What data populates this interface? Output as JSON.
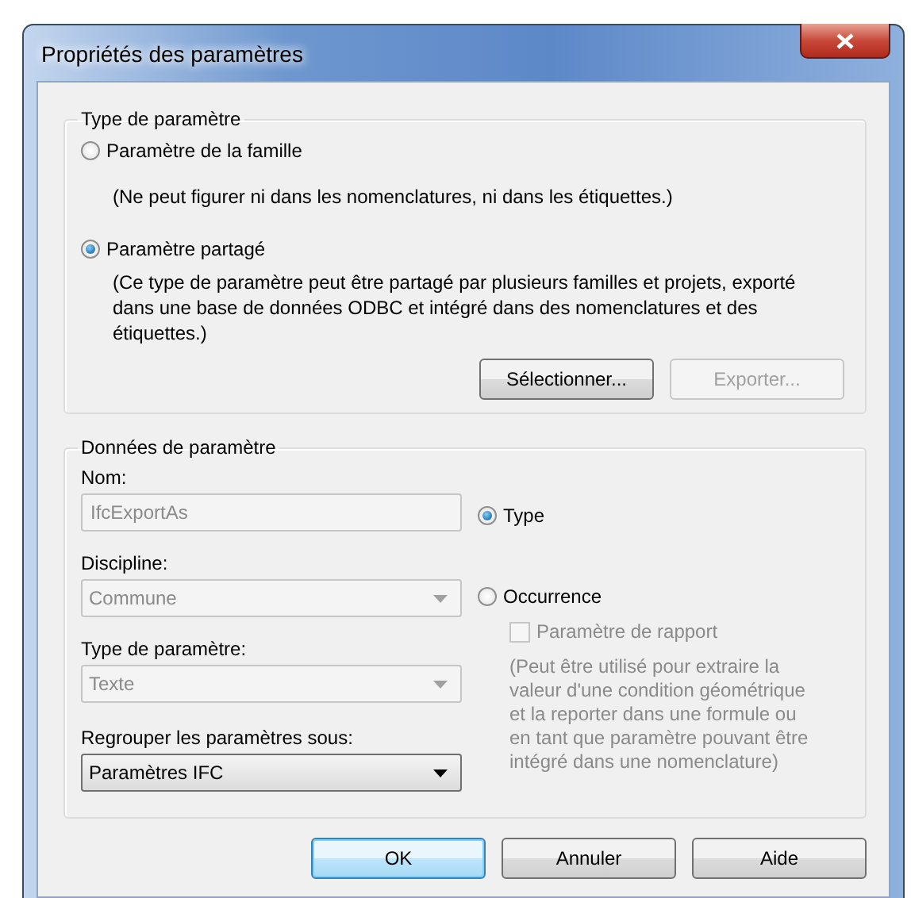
{
  "window": {
    "title": "Propriétés des paramètres"
  },
  "parameter_type": {
    "legend": "Type de paramètre",
    "options": [
      {
        "label": "Paramètre de la famille",
        "selected": false,
        "description": "(Ne peut figurer ni dans les nomenclatures, ni dans les étiquettes.)"
      },
      {
        "label": "Paramètre partagé",
        "selected": true,
        "description": "(Ce type de paramètre peut être partagé par plusieurs familles et projets, exporté dans une base de données ODBC et intégré dans des nomenclatures et des étiquettes.)"
      }
    ],
    "buttons": [
      {
        "label": "Sélectionner...",
        "disabled": false
      },
      {
        "label": "Exporter...",
        "disabled": true
      }
    ]
  },
  "parameter_data": {
    "legend": "Données de paramètre",
    "fields": [
      {
        "kind": "text",
        "label": "Nom:",
        "value": "IfcExportAs",
        "disabled": true
      },
      {
        "kind": "combo",
        "label": "Discipline:",
        "value": "Commune",
        "disabled": true
      },
      {
        "kind": "combo",
        "label": "Type de paramètre:",
        "value": "Texte",
        "disabled": true
      },
      {
        "kind": "combo",
        "label": "Regrouper les paramètres sous:",
        "value": "Paramètres IFC",
        "disabled": false
      }
    ],
    "instance_options": [
      {
        "label": "Type",
        "selected": true
      },
      {
        "label": "Occurrence",
        "selected": false
      }
    ],
    "reporting": {
      "label": "Paramètre de rapport",
      "checked": false,
      "disabled": true,
      "description": "(Peut être utilisé pour extraire la valeur d'une condition géométrique et la reporter dans une formule ou en tant que paramètre pouvant être intégré dans une nomenclature)"
    }
  },
  "buttons": [
    {
      "label": "OK",
      "default": true
    },
    {
      "label": "Annuler",
      "default": false
    },
    {
      "label": "Aide",
      "default": false
    }
  ]
}
